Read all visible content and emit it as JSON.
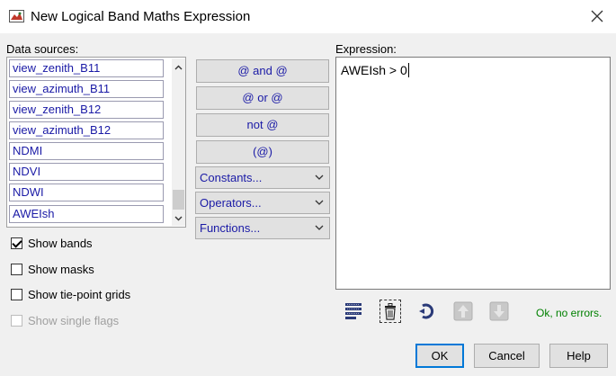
{
  "window": {
    "title": "New Logical Band Maths Expression",
    "icon": "band-maths-icon",
    "close_icon": "close-icon"
  },
  "data_sources": {
    "label": "Data sources:",
    "items": [
      "view_zenith_B11",
      "view_azimuth_B11",
      "view_zenith_B12",
      "view_azimuth_B12",
      "NDMI",
      "NDVI",
      "NDWI",
      "AWEIsh"
    ]
  },
  "options": {
    "show_bands": {
      "label": "Show bands",
      "checked": true
    },
    "show_masks": {
      "label": "Show masks",
      "checked": false
    },
    "show_tiepoint": {
      "label": "Show tie-point grids",
      "checked": false
    },
    "show_flags": {
      "label": "Show single flags",
      "checked": false,
      "enabled": false
    }
  },
  "operators": {
    "and": "@ and @",
    "or": "@ or @",
    "not": "not @",
    "paren": "(@)",
    "constants": "Constants...",
    "operators_menu": "Operators...",
    "functions": "Functions..."
  },
  "expression": {
    "label": "Expression:",
    "value": "AWEIsh > 0"
  },
  "toolbar": {
    "icons": [
      "edit-expression-icon",
      "delete-icon",
      "undo-icon",
      "history-up-icon",
      "history-down-icon"
    ],
    "status": "Ok, no errors."
  },
  "buttons": {
    "ok": "OK",
    "cancel": "Cancel",
    "help": "Help"
  },
  "colors": {
    "link_blue": "#1a1aa6",
    "status_green": "#008000",
    "focus_blue": "#0078d7"
  }
}
